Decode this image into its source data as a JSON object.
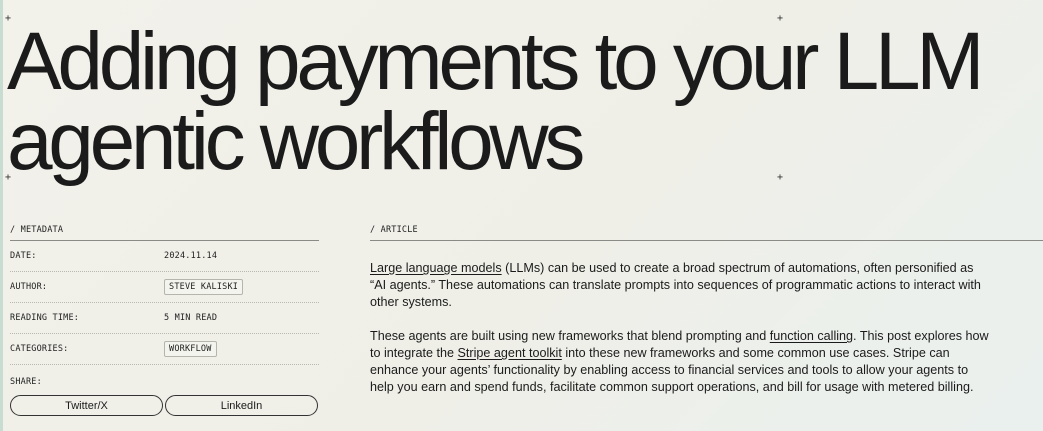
{
  "title_line1": "Adding payments to your LLM",
  "title_line2": "agentic workflows",
  "plus_glyph": "+",
  "metadata": {
    "section_label": "/ METADATA",
    "date_label": "DATE:",
    "date_value": "2024.11.14",
    "author_label": "AUTHOR:",
    "author_value": "STEVE KALISKI",
    "reading_time_label": "READING TIME:",
    "reading_time_value": "5 MIN READ",
    "categories_label": "CATEGORIES:",
    "categories_value": "WORKFLOW",
    "share_label": "SHARE:",
    "share_buttons": [
      "Twitter/X",
      "LinkedIn"
    ]
  },
  "article": {
    "section_label": "/ ARTICLE",
    "p1": {
      "link1": "Large language models",
      "text1": " (LLMs) can be used to create a broad spectrum of automations, often personified as “AI agents.” These automations can translate prompts into sequences of programmatic actions to interact with other systems."
    },
    "p2": {
      "text1": "These agents are built using new frameworks that blend prompting and ",
      "link1": "function calling",
      "text2": ". This post explores how to integrate the ",
      "link2": "Stripe agent toolkit",
      "text3": " into these new frameworks and some common use cases. Stripe can enhance your agents’ functionality by enabling access to financial services and tools to allow your agents to help you earn and spend funds, facilitate common support operations, and bill for usage with metered billing."
    }
  }
}
